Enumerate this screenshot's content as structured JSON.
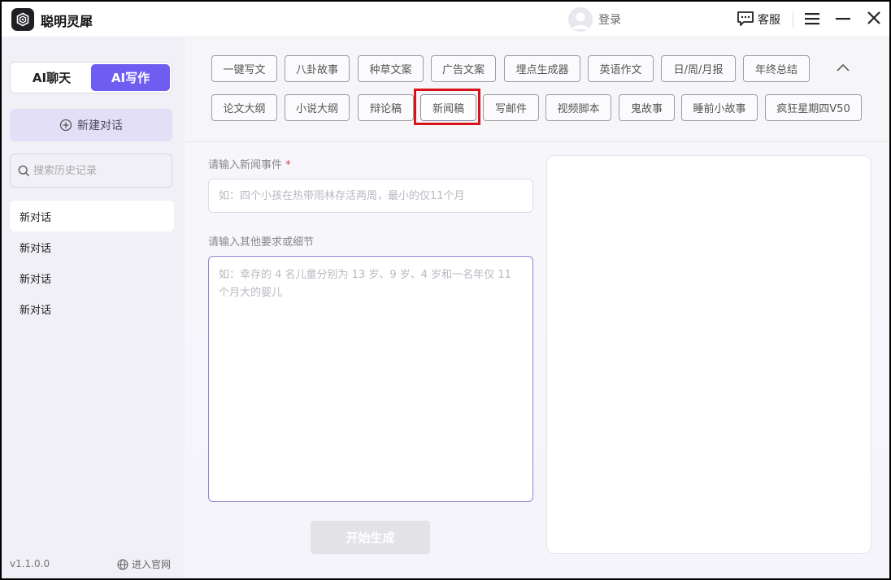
{
  "app": {
    "title": "聪明灵犀"
  },
  "titlebar": {
    "login_label": "登录",
    "service_label": "客服"
  },
  "sidebar": {
    "mode_chat": "AI聊天",
    "mode_write": "AI写作",
    "new_chat_label": "新建对话",
    "search_placeholder": "搜索历史记录",
    "history": [
      "新对话",
      "新对话",
      "新对话",
      "新对话"
    ],
    "version": "v1.1.0.0",
    "website_label": "进入官网"
  },
  "tags": {
    "row1": [
      "一键写文",
      "八卦故事",
      "种草文案",
      "广告文案",
      "埋点生成器",
      "英语作文",
      "日/周/月报",
      "年终总结"
    ],
    "row2": [
      "论文大纲",
      "小说大纲",
      "辩论稿",
      "新闻稿",
      "写邮件",
      "视频脚本",
      "鬼故事",
      "睡前小故事",
      "疯狂星期四V50"
    ],
    "selected": "新闻稿"
  },
  "form": {
    "event_label": "请输入新闻事件",
    "required_mark": "*",
    "event_placeholder": "如：四个小孩在热带雨林存活两周，最小的仅11个月",
    "detail_label": "请输入其他要求或细节",
    "detail_placeholder": "如：幸存的 4 名儿童分别为 13 岁、9 岁、4 岁和一名年仅 11 个月大的婴儿",
    "generate_label": "开始生成"
  },
  "colors": {
    "accent": "#6f5df2",
    "highlight": "#d7141c"
  }
}
